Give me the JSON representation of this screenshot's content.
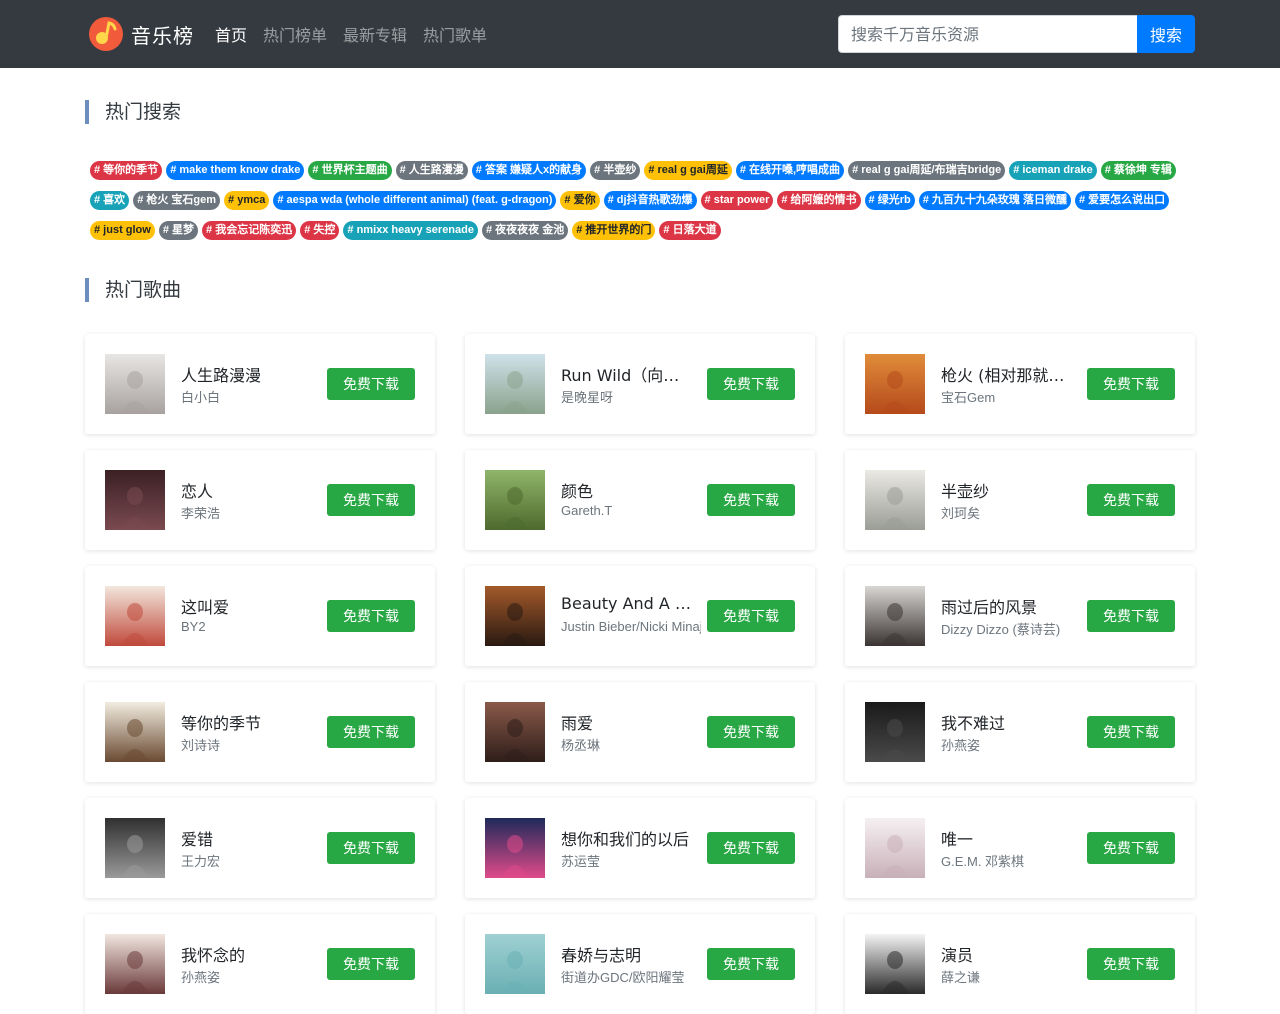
{
  "navbar": {
    "brand": "音乐榜",
    "links": [
      "首页",
      "热门榜单",
      "最新专辑",
      "热门歌单"
    ],
    "active_index": 0,
    "search": {
      "placeholder": "搜索千万音乐资源",
      "value": "",
      "button": "搜索"
    }
  },
  "hot_search": {
    "title": "热门搜索",
    "tags": [
      {
        "text": "# 等你的季节",
        "color": "danger"
      },
      {
        "text": "# make them know drake",
        "color": "primary"
      },
      {
        "text": "# 世界杯主题曲",
        "color": "success"
      },
      {
        "text": "# 人生路漫漫",
        "color": "secondary"
      },
      {
        "text": "# 答案 嫌疑人x的献身",
        "color": "primary"
      },
      {
        "text": "# 半壶纱",
        "color": "secondary"
      },
      {
        "text": "# real g gai周延",
        "color": "warning"
      },
      {
        "text": "# 在线开嗓,哼唱成曲",
        "color": "primary"
      },
      {
        "text": "# real g gai周延/布瑞吉bridge",
        "color": "secondary"
      },
      {
        "text": "# iceman drake",
        "color": "info"
      },
      {
        "text": "# 蔡徐坤 专辑",
        "color": "success"
      },
      {
        "text": "# 喜欢",
        "color": "info"
      },
      {
        "text": "# 枪火 宝石gem",
        "color": "secondary"
      },
      {
        "text": "# ymca",
        "color": "warning"
      },
      {
        "text": "# aespa wda (whole different animal) (feat. g-dragon)",
        "color": "primary"
      },
      {
        "text": "# 爱你",
        "color": "warning"
      },
      {
        "text": "# dj抖音热歌劲爆",
        "color": "primary"
      },
      {
        "text": "# star power",
        "color": "danger"
      },
      {
        "text": "# 给阿嬷的情书",
        "color": "danger"
      },
      {
        "text": "# 绿光rb",
        "color": "primary"
      },
      {
        "text": "# 九百九十九朵玫瑰 落日微醺",
        "color": "primary"
      },
      {
        "text": "# 爱要怎么说出口",
        "color": "primary"
      },
      {
        "text": "# just glow",
        "color": "warning"
      },
      {
        "text": "# 星梦",
        "color": "secondary"
      },
      {
        "text": "# 我会忘记陈奕迅",
        "color": "danger"
      },
      {
        "text": "# 失控",
        "color": "danger"
      },
      {
        "text": "# nmixx heavy serenade",
        "color": "info"
      },
      {
        "text": "# 夜夜夜夜 金池",
        "color": "secondary"
      },
      {
        "text": "# 推开世界的门",
        "color": "warning"
      },
      {
        "text": "# 日落大道",
        "color": "danger"
      }
    ]
  },
  "hot_songs": {
    "title": "热门歌曲",
    "download_label": "免费下载",
    "songs": [
      {
        "name": "人生路漫漫",
        "artist": "白小白",
        "cover": [
          "#e8e6e4",
          "#a7a2a0"
        ]
      },
      {
        "name": "Run Wild（向风而…",
        "artist": "是晚星呀",
        "cover": [
          "#cfe2ea",
          "#8aa28c"
        ]
      },
      {
        "name": "枪火 (相对那就针…",
        "artist": "宝石Gem",
        "cover": [
          "#e08c3a",
          "#b54a1c"
        ]
      },
      {
        "name": "恋人",
        "artist": "李荣浩",
        "cover": [
          "#3a2024",
          "#7a4a50"
        ]
      },
      {
        "name": "颜色",
        "artist": "Gareth.T",
        "cover": [
          "#8fb56a",
          "#4e6a2e"
        ]
      },
      {
        "name": "半壶纱",
        "artist": "刘珂矣",
        "cover": [
          "#ebe9e4",
          "#9a9d96"
        ]
      },
      {
        "name": "这叫爱",
        "artist": "BY2",
        "cover": [
          "#f3e6dc",
          "#c04a3c"
        ]
      },
      {
        "name": "Beauty And A Beat",
        "artist": "Justin Bieber/Nicki Minaj",
        "cover": [
          "#a35a2a",
          "#2a1a12"
        ]
      },
      {
        "name": "雨过后的风景",
        "artist": "Dizzy Dizzo (蔡诗芸)",
        "cover": [
          "#d8d6d2",
          "#3a3433"
        ]
      },
      {
        "name": "等你的季节",
        "artist": "刘诗诗",
        "cover": [
          "#f2ece0",
          "#6a4a32"
        ]
      },
      {
        "name": "雨爱",
        "artist": "杨丞琳",
        "cover": [
          "#8a5a4a",
          "#2e1e1a"
        ]
      },
      {
        "name": "我不难过",
        "artist": "孙燕姿",
        "cover": [
          "#1a1a1a",
          "#4a4a4a"
        ]
      },
      {
        "name": "爱错",
        "artist": "王力宏",
        "cover": [
          "#303030",
          "#9a9a9a"
        ]
      },
      {
        "name": "想你和我们的以后",
        "artist": "苏运莹",
        "cover": [
          "#1e2a5a",
          "#e04a8a"
        ]
      },
      {
        "name": "唯一",
        "artist": "G.E.M. 邓紫棋",
        "cover": [
          "#f6f0f2",
          "#c8b0b8"
        ]
      },
      {
        "name": "我怀念的",
        "artist": "孙燕姿",
        "cover": [
          "#f2e6e0",
          "#6a3a3a"
        ]
      },
      {
        "name": "春娇与志明",
        "artist": "街道办GDC/欧阳耀莹",
        "cover": [
          "#9fd0d2",
          "#6ab0b4"
        ]
      },
      {
        "name": "演员",
        "artist": "薛之谦",
        "cover": [
          "#f4f4f4",
          "#2a2a2a"
        ]
      }
    ]
  }
}
